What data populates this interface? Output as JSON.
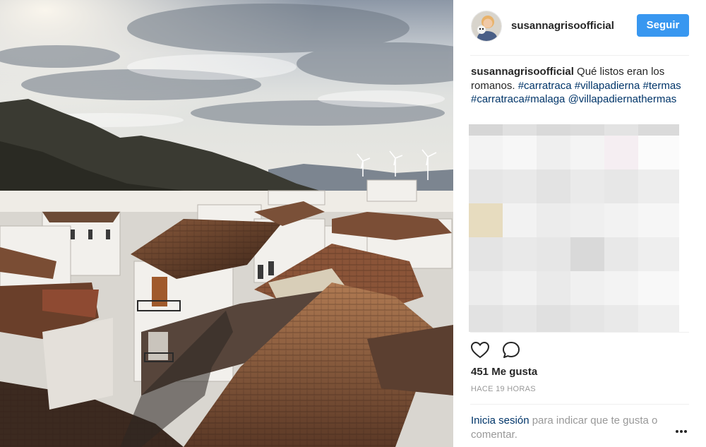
{
  "post": {
    "username": "susannagrisoofficial",
    "follow_label": "Seguir"
  },
  "caption": {
    "username": "susannagrisoofficial",
    "text": " Qué listos eran los romanos. ",
    "hashtags": [
      "#carratraca",
      "#villapadierna",
      "#termas",
      "#carratraca#malaga"
    ],
    "mention": "@villapadiernathermas"
  },
  "icons": {
    "like": "heart-icon",
    "comment": "comment-icon",
    "more": "more-options-icon"
  },
  "likes": {
    "text": "451 Me gusta"
  },
  "time": {
    "text": "HACE 19 HORAS"
  },
  "login": {
    "link": "Inicia sesión",
    "rest": " para indicar que te gusta o comentar."
  },
  "colors": {
    "accent": "#3897f0",
    "link": "#003569",
    "muted": "#999999"
  }
}
